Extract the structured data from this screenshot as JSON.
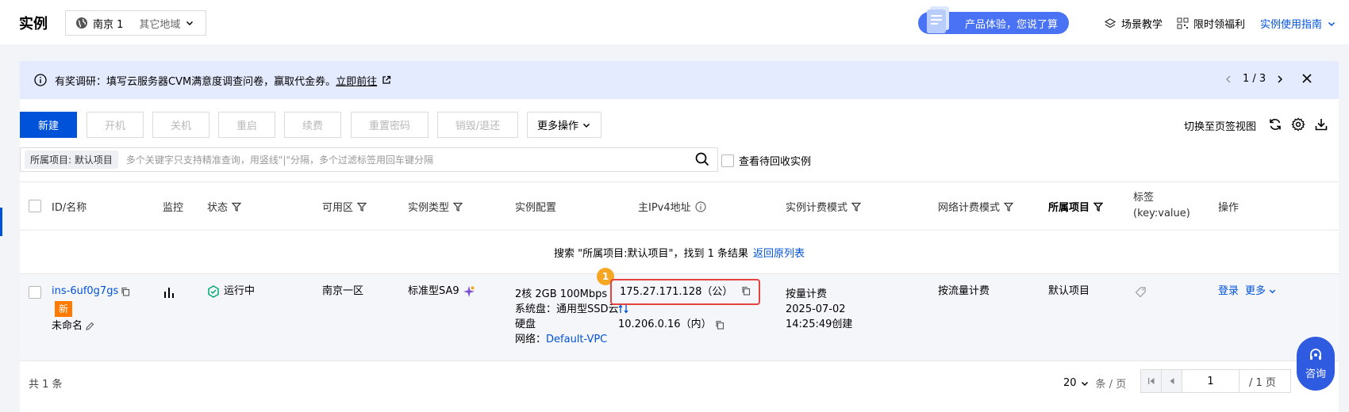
{
  "header": {
    "title": "实例",
    "region": "南京 1",
    "other_regions": "其它地域",
    "feedback": "产品体验，您说了算",
    "links": [
      "场景教学",
      "限时领福利",
      "实例使用指南"
    ]
  },
  "notice": {
    "text": "有奖调研：填写云服务器CVM满意度调查问卷，赢取代金券。",
    "link": "立即前往",
    "pager": "1 / 3"
  },
  "toolbar": {
    "buttons": [
      "新建",
      "开机",
      "关机",
      "重启",
      "续费",
      "重置密码",
      "销毁/退还",
      "更多操作"
    ],
    "switch_view": "切换至页签视图"
  },
  "search": {
    "tag": "所属项目: 默认项目",
    "placeholder": "多个关键字只支持精准查询，用竖线\"|\"分隔，多个过滤标签用回车键分隔",
    "recycle": "查看待回收实例"
  },
  "table": {
    "columns": {
      "id": "ID/名称",
      "monitor": "监控",
      "status": "状态",
      "zone": "可用区",
      "type": "实例类型",
      "config": "实例配置",
      "ip": "主IPv4地址",
      "billing": "实例计费模式",
      "net_billing": "网络计费模式",
      "project": "所属项目",
      "tag_1": "标签",
      "tag_2": "(key:value)",
      "ops": "操作"
    },
    "result_text": "搜索 \"所属项目:默认项目\"，找到 1 条结果",
    "result_back": "返回原列表",
    "row": {
      "id": "ins-6uf0g7gs",
      "new_badge": "新",
      "name": "未命名",
      "status": "运行中",
      "zone": "南京一区",
      "type": "标准型SA9",
      "config_line1": "2核 2GB 100Mbps",
      "config_line2": "系统盘：通用型SSD云",
      "config_line3": "硬盘",
      "network_label": "网络：",
      "network_value": "Default-VPC",
      "public_ip": "175.27.171.128（公）",
      "private_ip": "10.206.0.16（内）",
      "billing": "按量计费",
      "created_date": "2025-07-02",
      "created_time": "14:25:49创建",
      "net_billing": "按流量计费",
      "project": "默认项目",
      "login": "登录",
      "more": "更多",
      "marker": "1"
    }
  },
  "footer": {
    "total": "共 1 条",
    "page_size": "20",
    "page_size_unit": "条 / 页",
    "page": "1",
    "page_total": "/ 1 页"
  },
  "consult": "咨询",
  "colors": {
    "primary": "#0052d9",
    "notice_bg": "#e5ebff",
    "running": "#00a870",
    "highlight": "#e64340",
    "badge": "#ff7a00"
  }
}
